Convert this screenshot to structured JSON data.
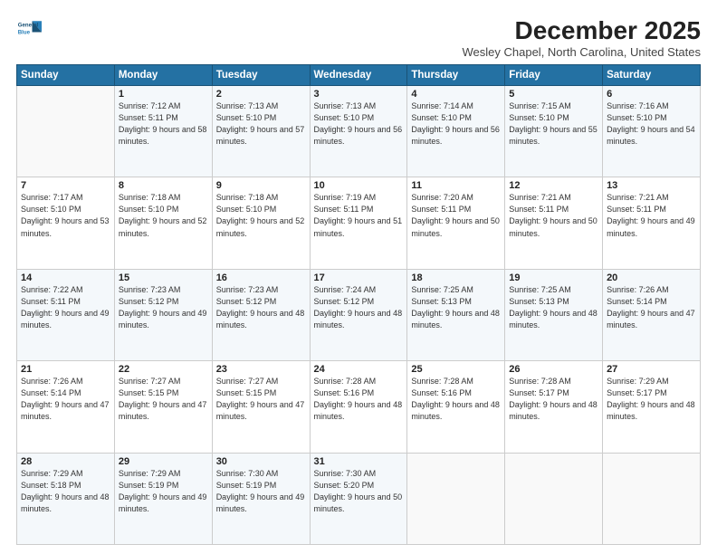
{
  "header": {
    "logo_line1": "General",
    "logo_line2": "Blue",
    "month": "December 2025",
    "location": "Wesley Chapel, North Carolina, United States"
  },
  "weekdays": [
    "Sunday",
    "Monday",
    "Tuesday",
    "Wednesday",
    "Thursday",
    "Friday",
    "Saturday"
  ],
  "weeks": [
    [
      {
        "day": "",
        "sunrise": "",
        "sunset": "",
        "daylight": ""
      },
      {
        "day": "1",
        "sunrise": "Sunrise: 7:12 AM",
        "sunset": "Sunset: 5:11 PM",
        "daylight": "Daylight: 9 hours and 58 minutes."
      },
      {
        "day": "2",
        "sunrise": "Sunrise: 7:13 AM",
        "sunset": "Sunset: 5:10 PM",
        "daylight": "Daylight: 9 hours and 57 minutes."
      },
      {
        "day": "3",
        "sunrise": "Sunrise: 7:13 AM",
        "sunset": "Sunset: 5:10 PM",
        "daylight": "Daylight: 9 hours and 56 minutes."
      },
      {
        "day": "4",
        "sunrise": "Sunrise: 7:14 AM",
        "sunset": "Sunset: 5:10 PM",
        "daylight": "Daylight: 9 hours and 56 minutes."
      },
      {
        "day": "5",
        "sunrise": "Sunrise: 7:15 AM",
        "sunset": "Sunset: 5:10 PM",
        "daylight": "Daylight: 9 hours and 55 minutes."
      },
      {
        "day": "6",
        "sunrise": "Sunrise: 7:16 AM",
        "sunset": "Sunset: 5:10 PM",
        "daylight": "Daylight: 9 hours and 54 minutes."
      }
    ],
    [
      {
        "day": "7",
        "sunrise": "Sunrise: 7:17 AM",
        "sunset": "Sunset: 5:10 PM",
        "daylight": "Daylight: 9 hours and 53 minutes."
      },
      {
        "day": "8",
        "sunrise": "Sunrise: 7:18 AM",
        "sunset": "Sunset: 5:10 PM",
        "daylight": "Daylight: 9 hours and 52 minutes."
      },
      {
        "day": "9",
        "sunrise": "Sunrise: 7:18 AM",
        "sunset": "Sunset: 5:10 PM",
        "daylight": "Daylight: 9 hours and 52 minutes."
      },
      {
        "day": "10",
        "sunrise": "Sunrise: 7:19 AM",
        "sunset": "Sunset: 5:11 PM",
        "daylight": "Daylight: 9 hours and 51 minutes."
      },
      {
        "day": "11",
        "sunrise": "Sunrise: 7:20 AM",
        "sunset": "Sunset: 5:11 PM",
        "daylight": "Daylight: 9 hours and 50 minutes."
      },
      {
        "day": "12",
        "sunrise": "Sunrise: 7:21 AM",
        "sunset": "Sunset: 5:11 PM",
        "daylight": "Daylight: 9 hours and 50 minutes."
      },
      {
        "day": "13",
        "sunrise": "Sunrise: 7:21 AM",
        "sunset": "Sunset: 5:11 PM",
        "daylight": "Daylight: 9 hours and 49 minutes."
      }
    ],
    [
      {
        "day": "14",
        "sunrise": "Sunrise: 7:22 AM",
        "sunset": "Sunset: 5:11 PM",
        "daylight": "Daylight: 9 hours and 49 minutes."
      },
      {
        "day": "15",
        "sunrise": "Sunrise: 7:23 AM",
        "sunset": "Sunset: 5:12 PM",
        "daylight": "Daylight: 9 hours and 49 minutes."
      },
      {
        "day": "16",
        "sunrise": "Sunrise: 7:23 AM",
        "sunset": "Sunset: 5:12 PM",
        "daylight": "Daylight: 9 hours and 48 minutes."
      },
      {
        "day": "17",
        "sunrise": "Sunrise: 7:24 AM",
        "sunset": "Sunset: 5:12 PM",
        "daylight": "Daylight: 9 hours and 48 minutes."
      },
      {
        "day": "18",
        "sunrise": "Sunrise: 7:25 AM",
        "sunset": "Sunset: 5:13 PM",
        "daylight": "Daylight: 9 hours and 48 minutes."
      },
      {
        "day": "19",
        "sunrise": "Sunrise: 7:25 AM",
        "sunset": "Sunset: 5:13 PM",
        "daylight": "Daylight: 9 hours and 48 minutes."
      },
      {
        "day": "20",
        "sunrise": "Sunrise: 7:26 AM",
        "sunset": "Sunset: 5:14 PM",
        "daylight": "Daylight: 9 hours and 47 minutes."
      }
    ],
    [
      {
        "day": "21",
        "sunrise": "Sunrise: 7:26 AM",
        "sunset": "Sunset: 5:14 PM",
        "daylight": "Daylight: 9 hours and 47 minutes."
      },
      {
        "day": "22",
        "sunrise": "Sunrise: 7:27 AM",
        "sunset": "Sunset: 5:15 PM",
        "daylight": "Daylight: 9 hours and 47 minutes."
      },
      {
        "day": "23",
        "sunrise": "Sunrise: 7:27 AM",
        "sunset": "Sunset: 5:15 PM",
        "daylight": "Daylight: 9 hours and 47 minutes."
      },
      {
        "day": "24",
        "sunrise": "Sunrise: 7:28 AM",
        "sunset": "Sunset: 5:16 PM",
        "daylight": "Daylight: 9 hours and 48 minutes."
      },
      {
        "day": "25",
        "sunrise": "Sunrise: 7:28 AM",
        "sunset": "Sunset: 5:16 PM",
        "daylight": "Daylight: 9 hours and 48 minutes."
      },
      {
        "day": "26",
        "sunrise": "Sunrise: 7:28 AM",
        "sunset": "Sunset: 5:17 PM",
        "daylight": "Daylight: 9 hours and 48 minutes."
      },
      {
        "day": "27",
        "sunrise": "Sunrise: 7:29 AM",
        "sunset": "Sunset: 5:17 PM",
        "daylight": "Daylight: 9 hours and 48 minutes."
      }
    ],
    [
      {
        "day": "28",
        "sunrise": "Sunrise: 7:29 AM",
        "sunset": "Sunset: 5:18 PM",
        "daylight": "Daylight: 9 hours and 48 minutes."
      },
      {
        "day": "29",
        "sunrise": "Sunrise: 7:29 AM",
        "sunset": "Sunset: 5:19 PM",
        "daylight": "Daylight: 9 hours and 49 minutes."
      },
      {
        "day": "30",
        "sunrise": "Sunrise: 7:30 AM",
        "sunset": "Sunset: 5:19 PM",
        "daylight": "Daylight: 9 hours and 49 minutes."
      },
      {
        "day": "31",
        "sunrise": "Sunrise: 7:30 AM",
        "sunset": "Sunset: 5:20 PM",
        "daylight": "Daylight: 9 hours and 50 minutes."
      },
      {
        "day": "",
        "sunrise": "",
        "sunset": "",
        "daylight": ""
      },
      {
        "day": "",
        "sunrise": "",
        "sunset": "",
        "daylight": ""
      },
      {
        "day": "",
        "sunrise": "",
        "sunset": "",
        "daylight": ""
      }
    ]
  ]
}
